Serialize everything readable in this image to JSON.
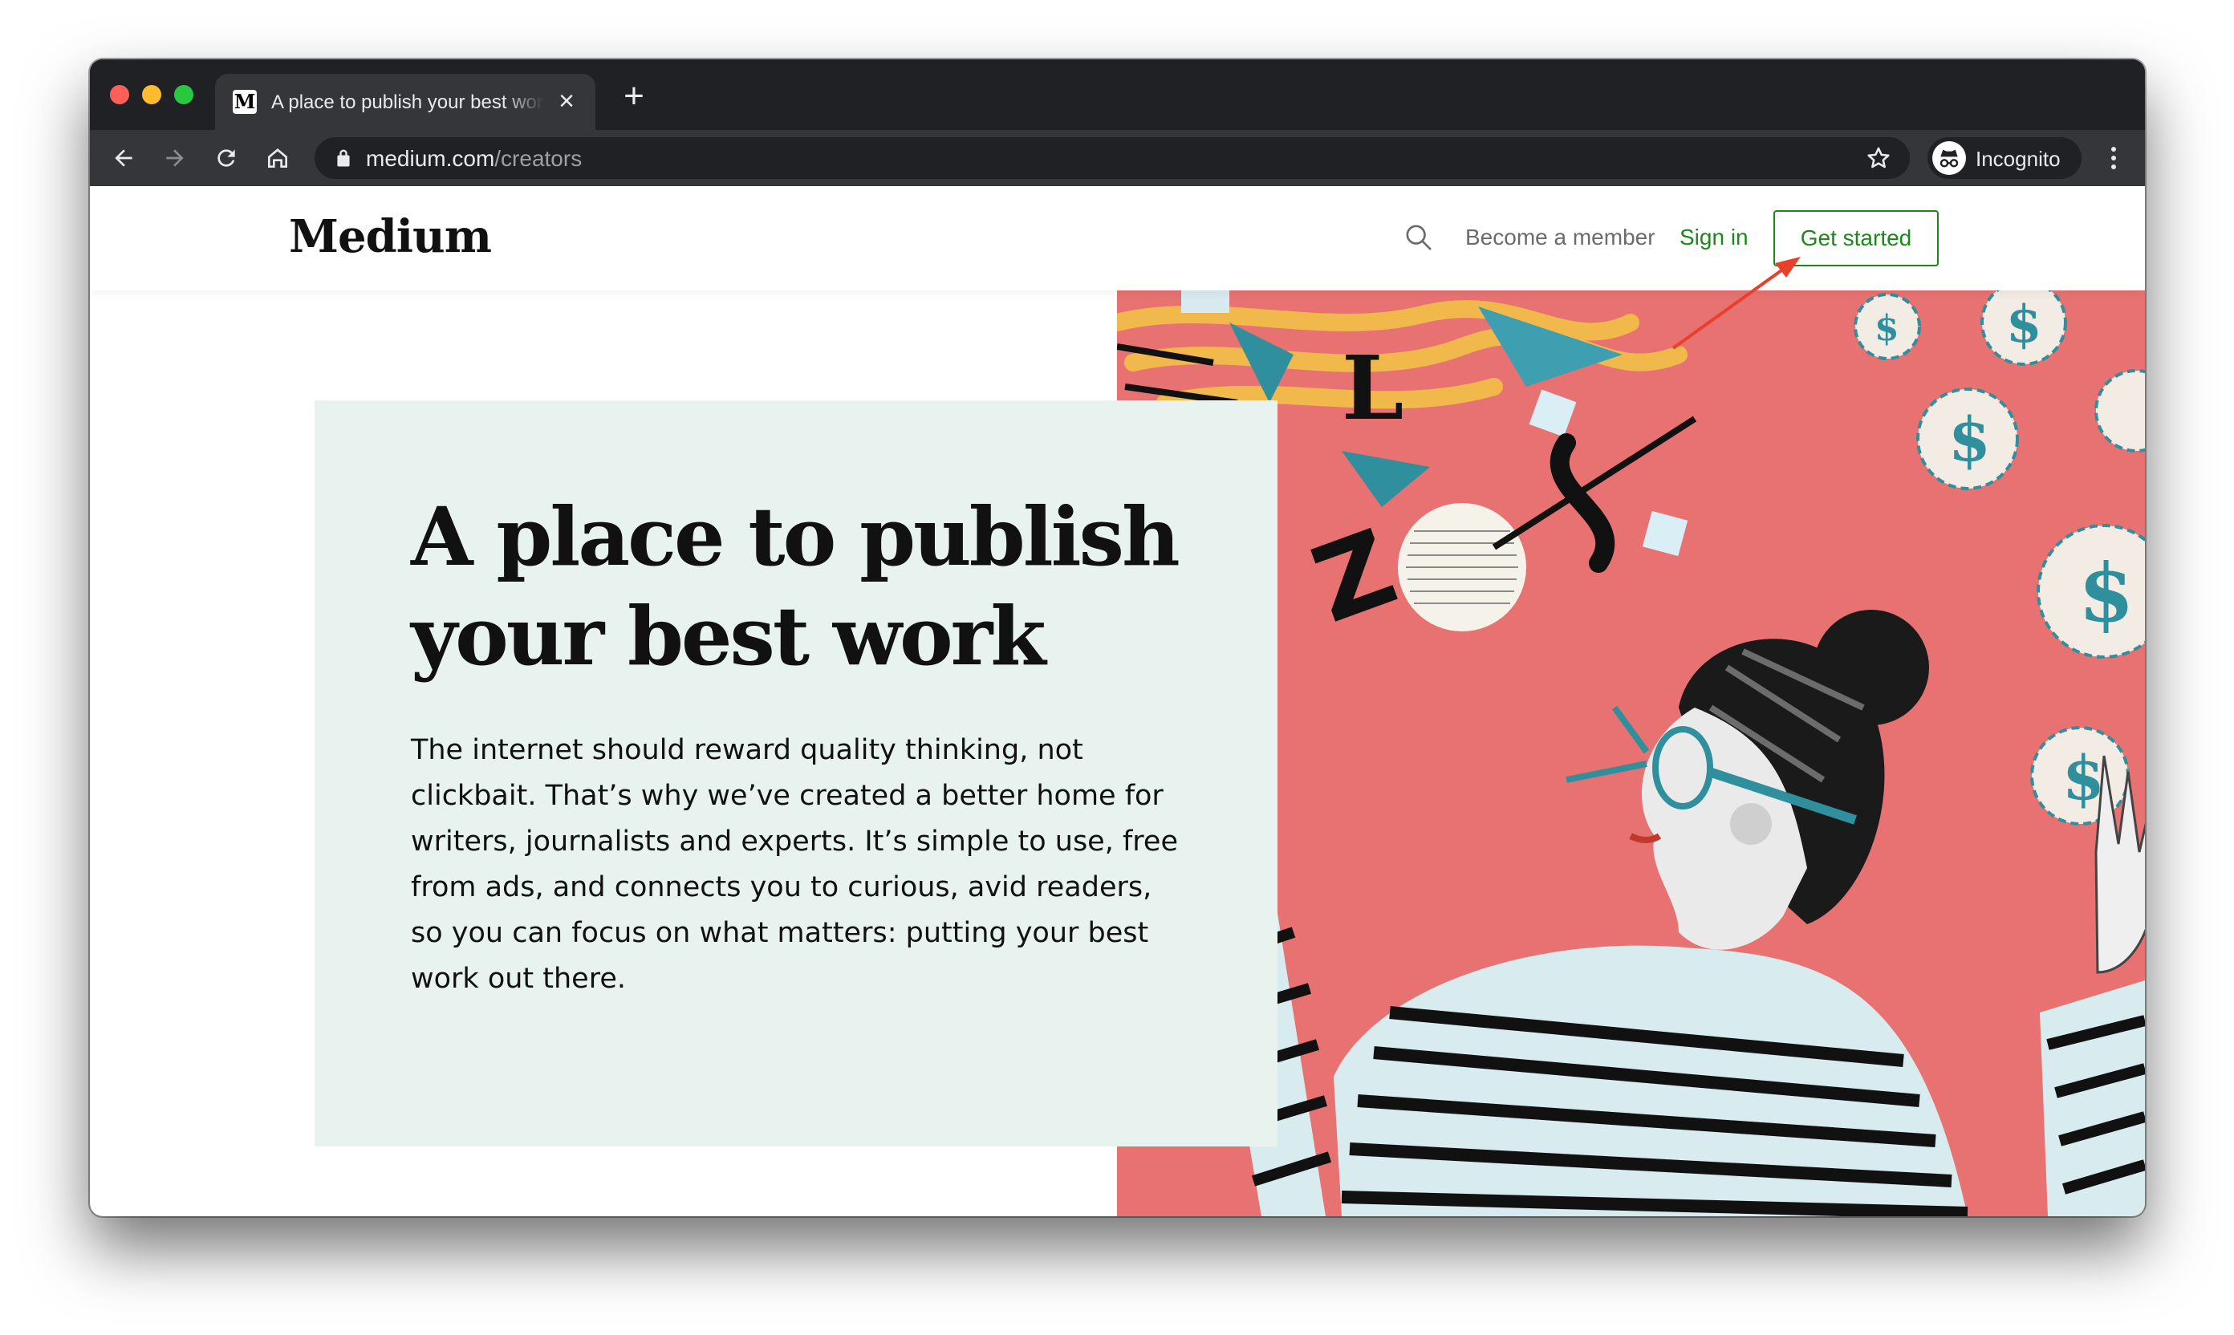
{
  "browser": {
    "tab": {
      "favicon": "M",
      "title": "A place to publish your best work"
    },
    "url": {
      "host": "medium.com",
      "path": "/creators"
    },
    "profile_label": "Incognito"
  },
  "site": {
    "logo": "Medium",
    "nav": {
      "member": "Become a member",
      "signin": "Sign in",
      "get_started": "Get started"
    },
    "hero": {
      "headline": "A place to publish your best work",
      "body": "The internet should reward quality thinking, not clickbait. That’s why we’ve created a better home for writers, journalists and experts. It’s simple to use, free from ads, and connects you to curious, avid readers, so you can focus on what matters: putting your best work out there."
    }
  },
  "colors": {
    "brand_green": "#1a8917",
    "hero_card_bg": "#e8f2ee",
    "art_bg": "#e87272",
    "annotation_arrow": "#e8402a"
  }
}
